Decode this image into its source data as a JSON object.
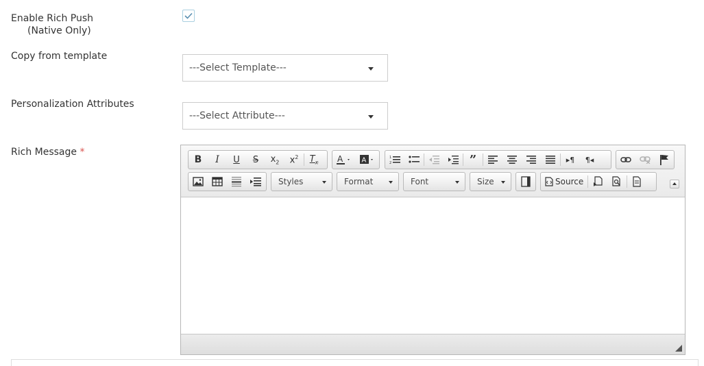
{
  "fields": {
    "rich_push": {
      "label": "Enable Rich Push",
      "sublabel": "(Native Only)",
      "checked": true
    },
    "template": {
      "label": "Copy from template",
      "selected": "---Select Template---"
    },
    "attributes": {
      "label": "Personalization Attributes",
      "selected": "---Select Attribute---"
    },
    "rich_message": {
      "label": "Rich Message",
      "required_marker": "*"
    }
  },
  "editor": {
    "combos": {
      "styles": "Styles",
      "format": "Format",
      "font": "Font",
      "size": "Size"
    },
    "source_label": "Source"
  },
  "colors": {
    "required": "#d9534f",
    "check": "#5a8fb0"
  }
}
